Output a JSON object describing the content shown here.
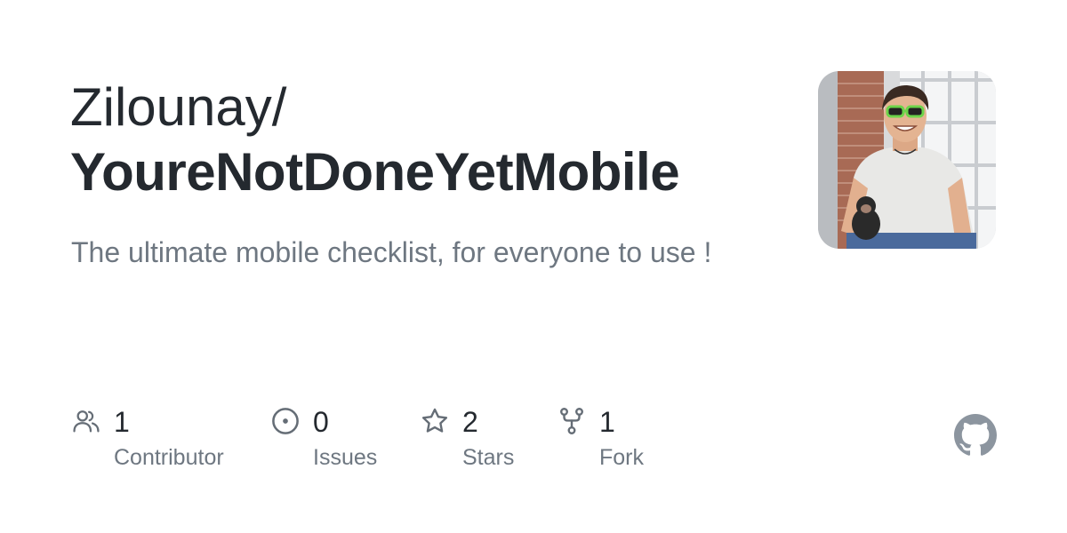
{
  "repo": {
    "owner": "Zilounay/",
    "name": "YoureNotDoneYetMobile",
    "description": "The ultimate mobile checklist, for everyone to use !"
  },
  "avatar": {
    "icon": "user-avatar-photo"
  },
  "stats": [
    {
      "icon": "people-icon",
      "value": "1",
      "label": "Contributor"
    },
    {
      "icon": "issue-opened-icon",
      "value": "0",
      "label": "Issues"
    },
    {
      "icon": "star-icon",
      "value": "2",
      "label": "Stars"
    },
    {
      "icon": "repo-forked-icon",
      "value": "1",
      "label": "Fork"
    }
  ],
  "colors": {
    "title": "#24292f",
    "muted": "#6e7781",
    "icon": "#656d76",
    "github_logo": "#8c959f"
  }
}
